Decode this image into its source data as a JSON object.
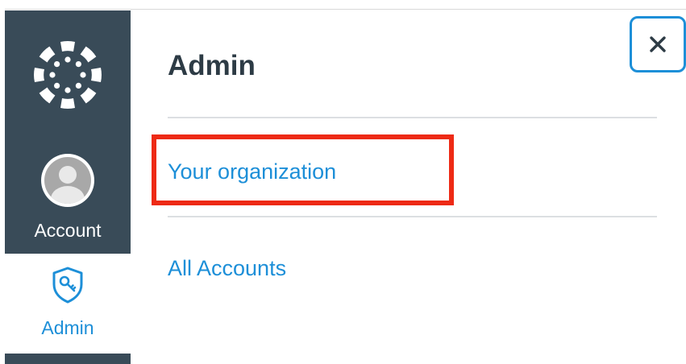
{
  "nav": {
    "account_label": "Account",
    "admin_label": "Admin"
  },
  "tray": {
    "title": "Admin",
    "links": [
      {
        "label": "Your organization"
      },
      {
        "label": "All Accounts"
      }
    ]
  },
  "colors": {
    "nav_bg": "#394b58",
    "link": "#1d8fd8",
    "highlight": "#ee2a15",
    "title": "#2d3b45"
  },
  "icons": {
    "logo": "canvas-logo-icon",
    "avatar": "user-avatar-icon",
    "admin": "shield-key-icon",
    "close": "close-icon"
  }
}
